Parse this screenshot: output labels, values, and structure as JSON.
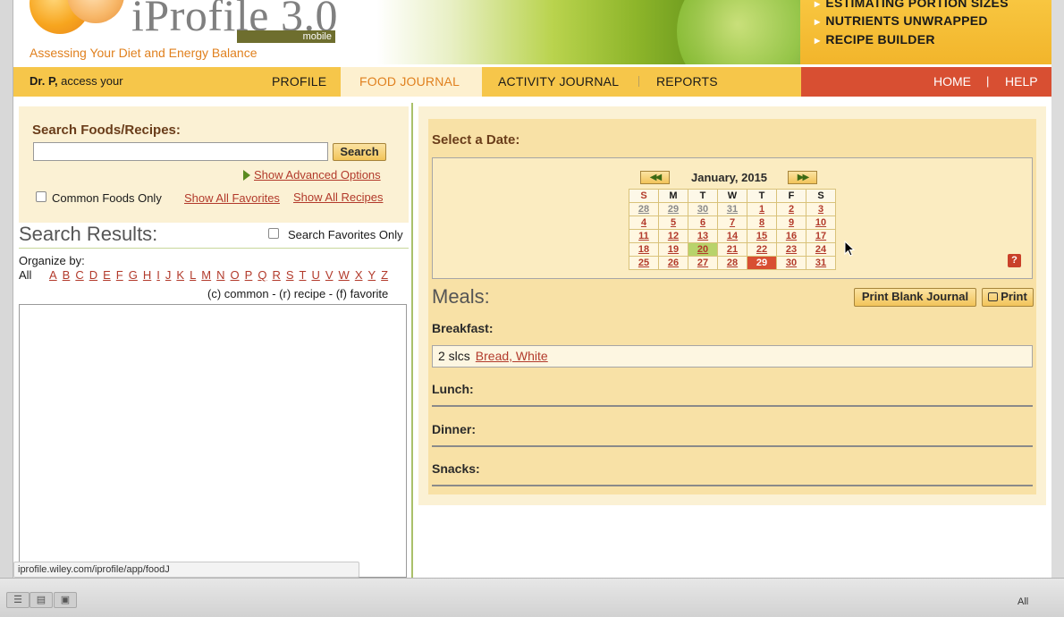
{
  "header": {
    "logo_title": "iProfile 3.0",
    "logo_badge": "mobile",
    "tagline": "Assessing Your Diet and Energy Balance",
    "promos": [
      "ESTIMATING PORTION SIZES",
      "NUTRIENTS UNWRAPPED",
      "RECIPE BUILDER"
    ]
  },
  "nav": {
    "greeting_name": "Dr. P,",
    "greeting_rest": " access your",
    "items": [
      "PROFILE",
      "FOOD JOURNAL",
      "ACTIVITY JOURNAL",
      "REPORTS"
    ],
    "active_index": 1,
    "right_items": [
      "HOME",
      "HELP"
    ]
  },
  "search": {
    "title": "Search Foods/Recipes:",
    "input_value": "",
    "button": "Search",
    "advanced_link": "Show Advanced Options",
    "common_only": "Common Foods Only",
    "favorites_link": "Show All Favorites",
    "recipes_link": "Show All Recipes"
  },
  "results": {
    "title": "Search Results:",
    "favorites_only": "Search Favorites Only",
    "organize_by": "Organize by:",
    "all_label": "All",
    "letters": [
      "A",
      "B",
      "C",
      "D",
      "E",
      "F",
      "G",
      "H",
      "I",
      "J",
      "K",
      "L",
      "M",
      "N",
      "O",
      "P",
      "Q",
      "R",
      "S",
      "T",
      "U",
      "V",
      "W",
      "X",
      "Y",
      "Z"
    ],
    "legend": "(c) common - (r) recipe - (f) favorite"
  },
  "calendar": {
    "title": "Select a Date:",
    "prev_button": "◀◀",
    "next_button": "▶▶",
    "month": "January, 2015",
    "days_of_week": [
      "S",
      "M",
      "T",
      "W",
      "T",
      "F",
      "S"
    ],
    "weeks": [
      [
        "28",
        "29",
        "30",
        "31",
        "1",
        "2",
        "3"
      ],
      [
        "4",
        "5",
        "6",
        "7",
        "8",
        "9",
        "10"
      ],
      [
        "11",
        "12",
        "13",
        "14",
        "15",
        "16",
        "17"
      ],
      [
        "18",
        "19",
        "20",
        "21",
        "22",
        "23",
        "24"
      ],
      [
        "25",
        "26",
        "27",
        "28",
        "29",
        "30",
        "31"
      ]
    ],
    "help": "?"
  },
  "meals": {
    "title": "Meals:",
    "print_blank": "Print Blank Journal",
    "print": "Print",
    "breakfast_label": "Breakfast:",
    "breakfast_qty": "2 slcs",
    "breakfast_food": "Bread, White",
    "lunch_label": "Lunch:",
    "dinner_label": "Dinner:",
    "snacks_label": "Snacks:"
  },
  "status": {
    "url": "iprofile.wiley.com/iprofile/app/foodJ",
    "bottom_right": "All"
  }
}
